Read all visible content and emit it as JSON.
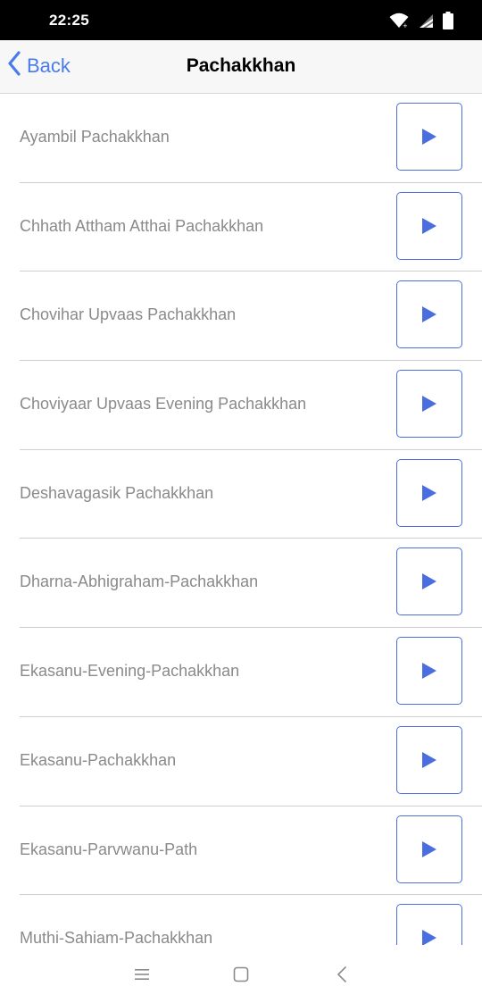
{
  "status_bar": {
    "time": "22:25",
    "icons": [
      "wifi-icon",
      "signal-icon",
      "battery-icon"
    ]
  },
  "header": {
    "back_label": "Back",
    "title": "Pachakkhan"
  },
  "list": {
    "items": [
      {
        "label": "Ayambil Pachakkhan"
      },
      {
        "label": "Chhath Attham Atthai Pachakkhan"
      },
      {
        "label": "Chovihar Upvaas Pachakkhan"
      },
      {
        "label": "Choviyaar Upvaas Evening Pachakkhan"
      },
      {
        "label": "Deshavagasik Pachakkhan"
      },
      {
        "label": "Dharna-Abhigraham-Pachakkhan"
      },
      {
        "label": "Ekasanu-Evening-Pachakkhan"
      },
      {
        "label": "Ekasanu-Pachakkhan"
      },
      {
        "label": "Ekasanu-Parvwanu-Path"
      },
      {
        "label": "Muthi-Sahiam-Pachakkhan"
      }
    ],
    "play_icon": "play-icon"
  },
  "system_nav": {
    "icons": [
      "menu-icon",
      "home-icon",
      "back-icon"
    ]
  },
  "colors": {
    "accent": "#4a7bec",
    "play_border": "#4a6ee0",
    "label_text": "#8a8a8a",
    "divider": "#cfcfcf"
  }
}
